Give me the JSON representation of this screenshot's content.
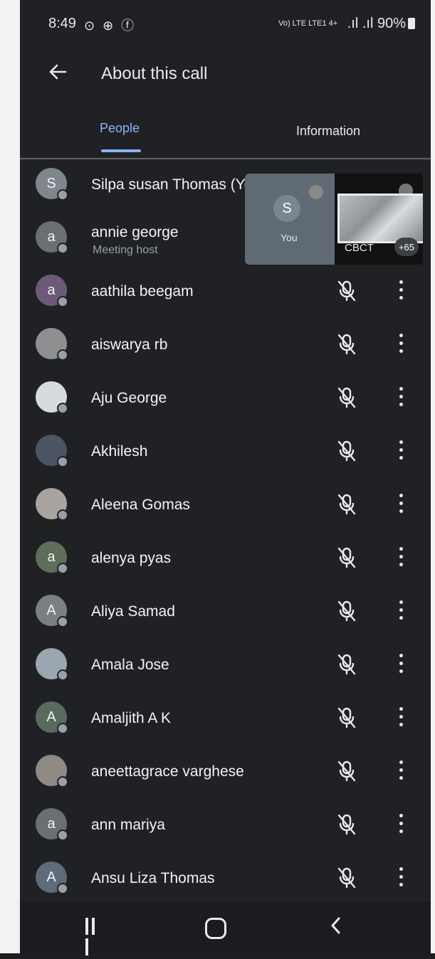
{
  "status_bar": {
    "time": "8:49",
    "left_icons": "⊙ ⊕ ⓕ",
    "network": "Vo) LTE LTE1 4+",
    "signal": ".ıl .ıl",
    "battery": "90%"
  },
  "app_bar": {
    "title": "About this call"
  },
  "tabs": {
    "people": "People",
    "information": "Information"
  },
  "pip": {
    "self_initial": "S",
    "self_label": "You",
    "other_label": "CBCT",
    "others_count": "+65"
  },
  "participants": [
    {
      "name": "Silpa susan Thomas (You)",
      "initial": "S",
      "avatar_color": "#7f868c"
    },
    {
      "name": "annie george",
      "subtitle": "Meeting host",
      "initial": "a",
      "avatar_color": "#6c6f72"
    },
    {
      "name": "aathila beegam",
      "initial": "a",
      "avatar_color": "#6e5a78"
    },
    {
      "name": "aiswarya rb",
      "initial": "",
      "avatar_color": "#8d8f91"
    },
    {
      "name": "Aju George",
      "initial": "",
      "avatar_color": "#d8dbdd"
    },
    {
      "name": "Akhilesh",
      "initial": "",
      "avatar_color": "#4b5563"
    },
    {
      "name": "Aleena Gomas",
      "initial": "",
      "avatar_color": "#a9a4a0"
    },
    {
      "name": "alenya pyas",
      "initial": "a",
      "avatar_color": "#5f6e5b"
    },
    {
      "name": "Aliya Samad",
      "initial": "A",
      "avatar_color": "#7b7f83"
    },
    {
      "name": "Amala Jose",
      "initial": "",
      "avatar_color": "#9aa6b0"
    },
    {
      "name": "Amaljith A K",
      "initial": "A",
      "avatar_color": "#5b6a5f"
    },
    {
      "name": "aneettagrace varghese",
      "initial": "",
      "avatar_color": "#8f8a85"
    },
    {
      "name": "ann mariya",
      "initial": "a",
      "avatar_color": "#6b6e72"
    },
    {
      "name": "Ansu Liza Thomas",
      "initial": "A",
      "avatar_color": "#5d6b7a"
    }
  ]
}
